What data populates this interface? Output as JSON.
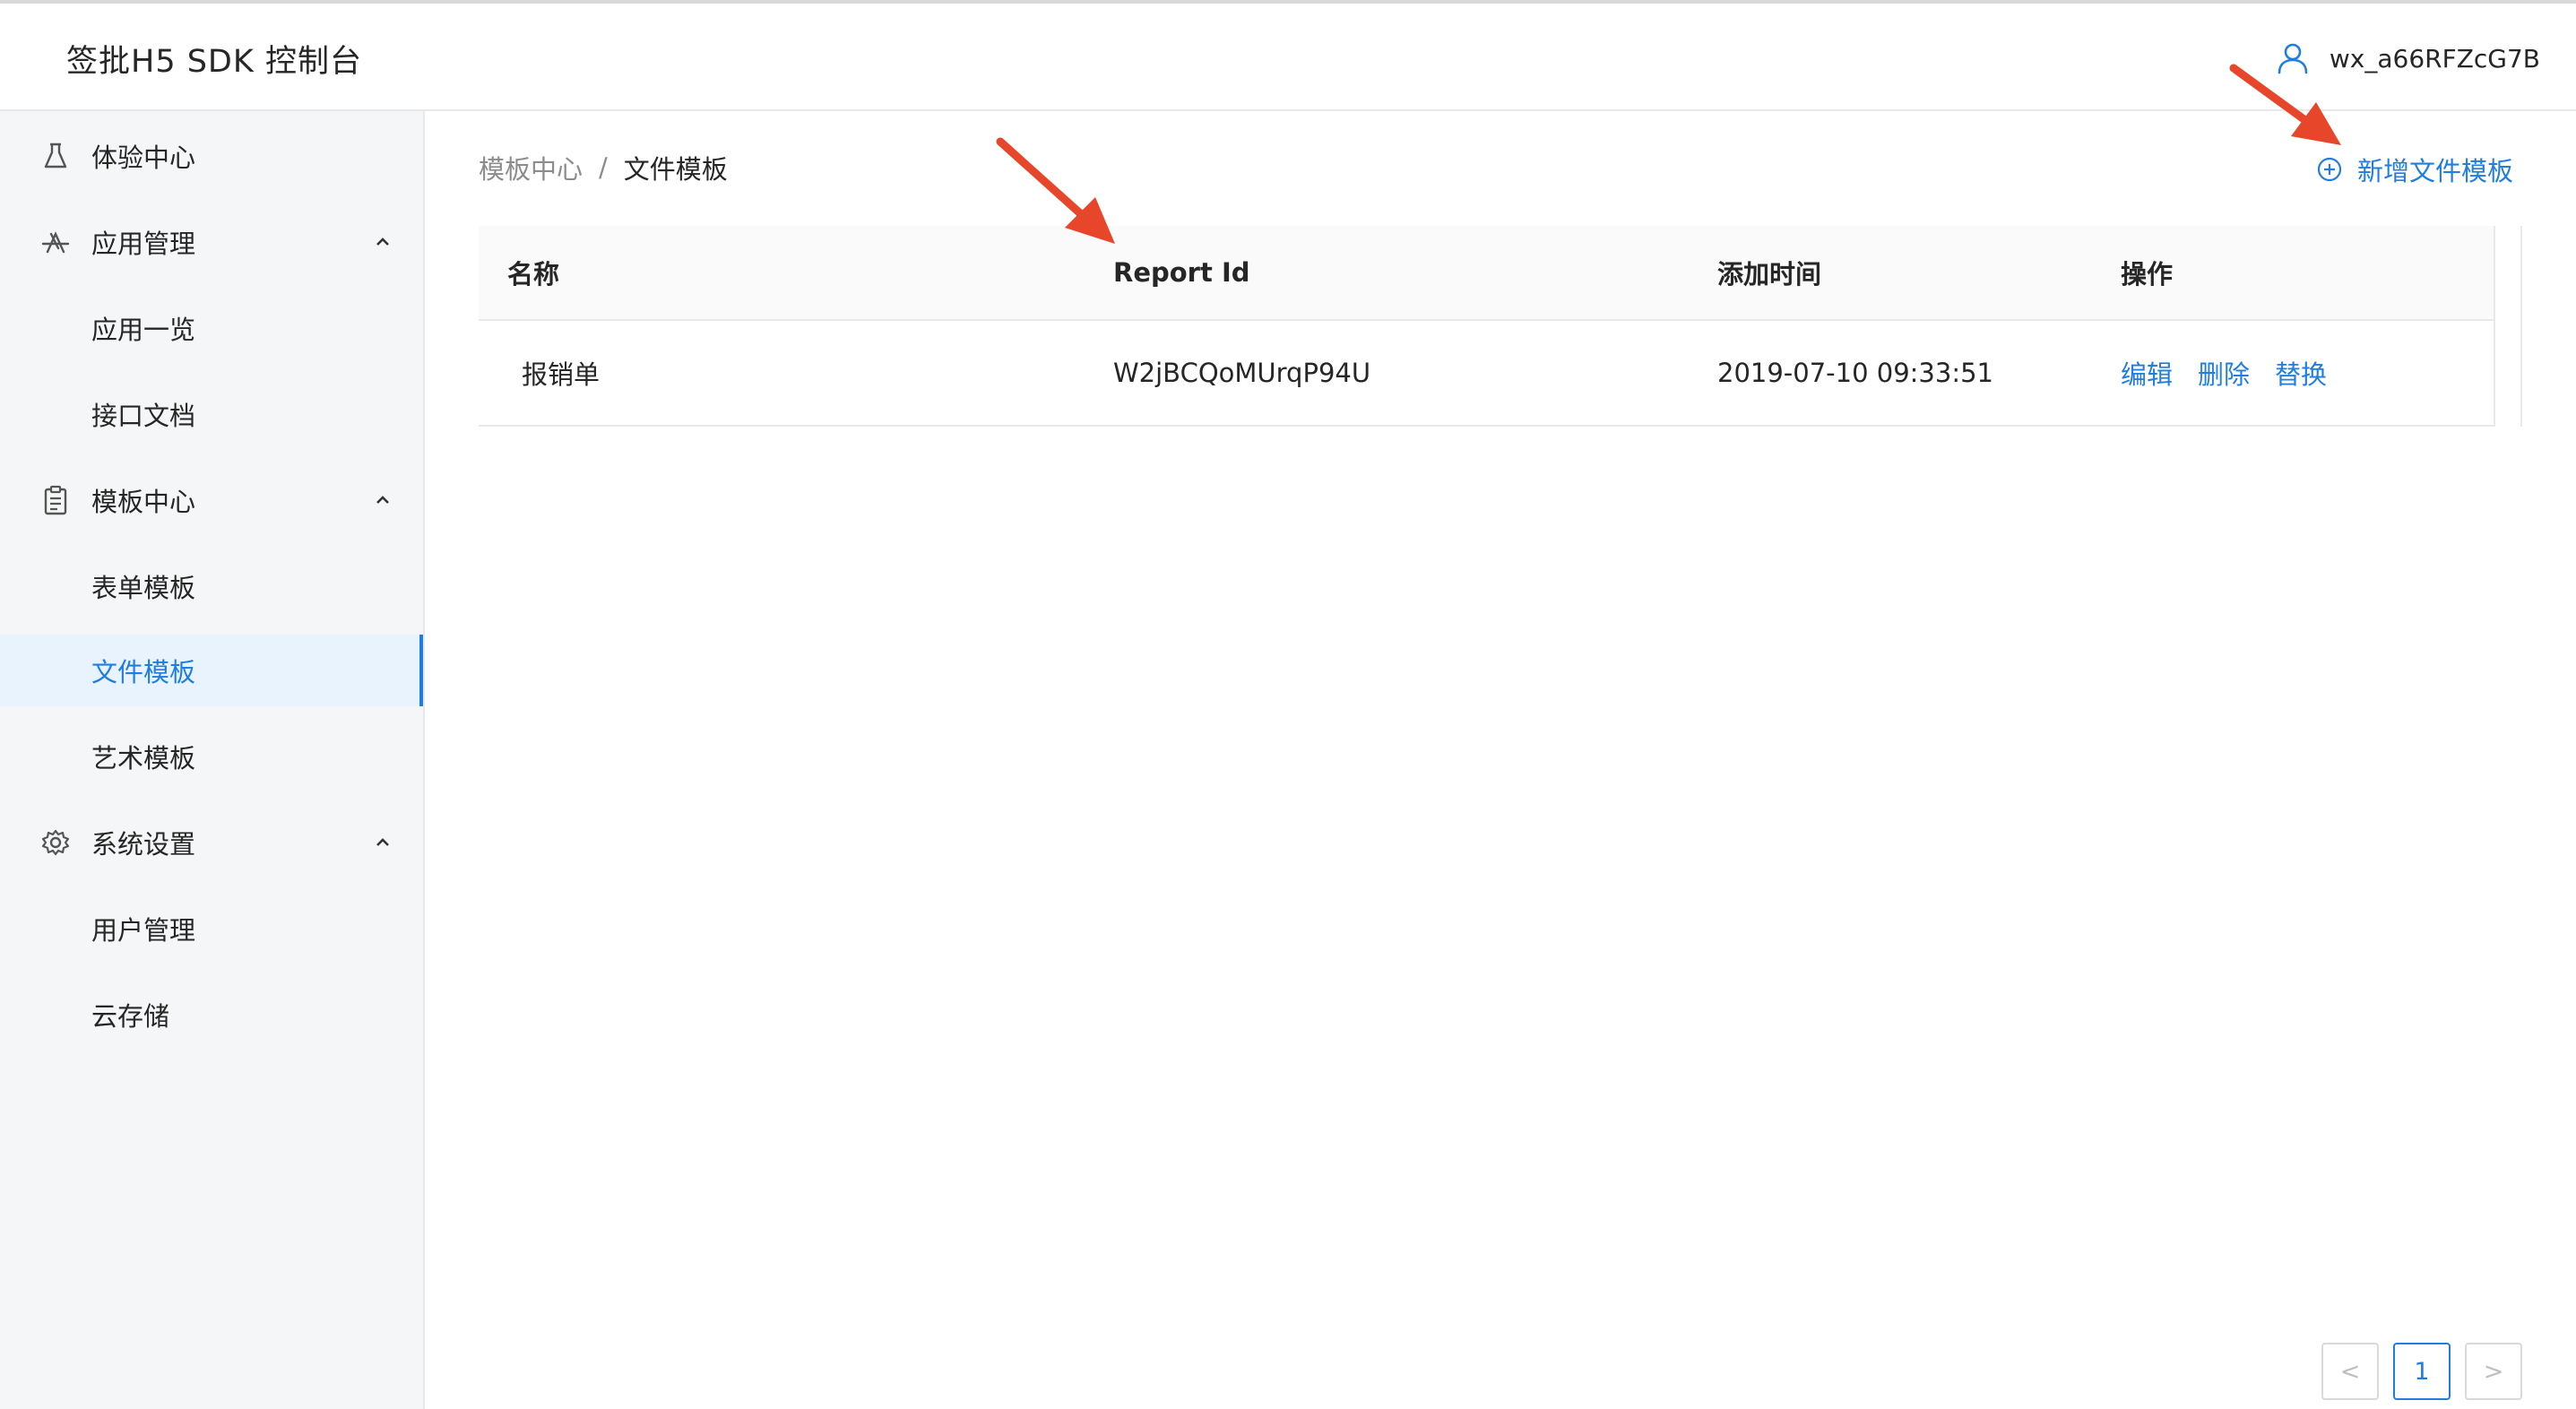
{
  "header": {
    "app_title": "签批H5 SDK 控制台",
    "username": "wx_a66RFZcG7B",
    "user_icon": "user-icon"
  },
  "sidebar": {
    "items": [
      {
        "label": "体验中心",
        "icon": "flask-icon",
        "type": "top"
      },
      {
        "label": "应用管理",
        "icon": "app-store-icon",
        "type": "group",
        "expanded": true
      },
      {
        "label": "应用一览",
        "type": "sub"
      },
      {
        "label": "接口文档",
        "type": "sub"
      },
      {
        "label": "模板中心",
        "icon": "clipboard-icon",
        "type": "group",
        "expanded": true
      },
      {
        "label": "表单模板",
        "type": "sub"
      },
      {
        "label": "文件模板",
        "type": "sub",
        "active": true
      },
      {
        "label": "艺术模板",
        "type": "sub"
      },
      {
        "label": "系统设置",
        "icon": "gear-icon",
        "type": "group",
        "expanded": true
      },
      {
        "label": "用户管理",
        "type": "sub"
      },
      {
        "label": "云存储",
        "type": "sub"
      }
    ]
  },
  "breadcrumb": {
    "parent": "模板中心",
    "separator": "/",
    "current": "文件模板"
  },
  "actions": {
    "add_label": "新增文件模板",
    "add_icon": "plus-circle-icon"
  },
  "table": {
    "columns": [
      "名称",
      "Report Id",
      "添加时间",
      "操作"
    ],
    "rows": [
      {
        "name": "报销单",
        "report_id": "W2jBCQoMUrqP94U",
        "added_time": "2019-07-10 09:33:51",
        "ops": [
          "编辑",
          "删除",
          "替换"
        ]
      }
    ]
  },
  "pagination": {
    "prev": "<",
    "current_page": "1",
    "next": ">"
  },
  "colors": {
    "accent": "#1f7ee0",
    "annotation_arrow": "#e8462a",
    "sidebar_bg": "#f5f6f7",
    "active_bg": "#e8f3fe"
  }
}
